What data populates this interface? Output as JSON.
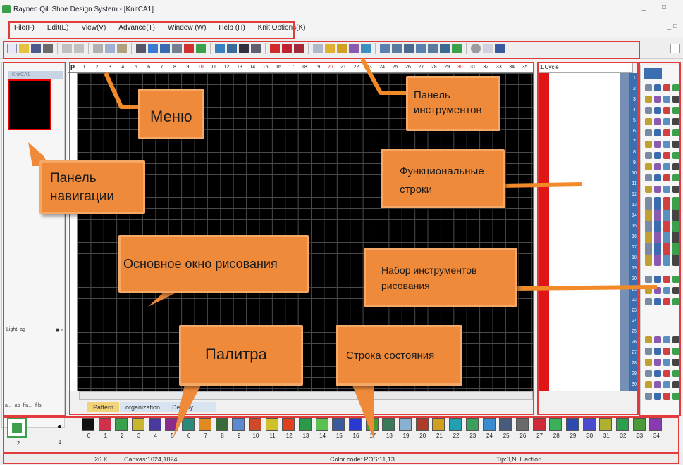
{
  "window": {
    "title": "Raynen Qili Shoe Design System - [KnitCA1]",
    "controls": "_ □"
  },
  "menu": {
    "items": [
      "File(F)",
      "Edit(E)",
      "View(V)",
      "Advance(T)",
      "Window (W)",
      "Help (H)",
      "Knit Options(K)"
    ],
    "mdi_controls": "_ □"
  },
  "nav": {
    "doc_tab": "KnitCA1",
    "layer_label": "Light. ag",
    "tabs": [
      "a...",
      "ao",
      "ffa...",
      "fils"
    ]
  },
  "ruler": {
    "corner": "P",
    "numbers": [
      "1",
      "2",
      "3",
      "4",
      "5",
      "6",
      "7",
      "8",
      "9",
      "10",
      "11",
      "12",
      "13",
      "14",
      "15",
      "16",
      "17",
      "18",
      "19",
      "20",
      "21",
      "22",
      "23",
      "24",
      "25",
      "26",
      "27",
      "28",
      "29",
      "30",
      "31",
      "32",
      "33",
      "34",
      "35"
    ],
    "red_numbers": [
      "10",
      "20",
      "30"
    ]
  },
  "function_panel": {
    "header": "1.Cycle",
    "row_numbers": [
      "1",
      "2",
      "3",
      "4",
      "5",
      "6",
      "7",
      "8",
      "9",
      "10",
      "11",
      "12",
      "13",
      "14",
      "15",
      "16",
      "17",
      "18",
      "19",
      "20",
      "21",
      "22",
      "23",
      "24",
      "25",
      "26",
      "27",
      "28",
      "29",
      "30"
    ]
  },
  "bottom_tabs": [
    "Pattern",
    "organization",
    "Density",
    "..."
  ],
  "palette": {
    "first_label": "2",
    "second_label": "1",
    "swatches": [
      {
        "label": "0",
        "color": "#111111"
      },
      {
        "label": "1",
        "color": "#d0304a"
      },
      {
        "label": "2",
        "color": "#3aa04b"
      },
      {
        "label": "3",
        "color": "#c8b530"
      },
      {
        "label": "4",
        "color": "#4a3aa0"
      },
      {
        "label": "5",
        "color": "#8b2a8b"
      },
      {
        "label": "6",
        "color": "#2a8b7a"
      },
      {
        "label": "7",
        "color": "#e08a20"
      },
      {
        "label": "8",
        "color": "#3a6a3a"
      },
      {
        "label": "9",
        "color": "#5a8ad0"
      },
      {
        "label": "10",
        "color": "#d04a2a"
      },
      {
        "label": "11",
        "color": "#d0c02a"
      },
      {
        "label": "12",
        "color": "#e04020"
      },
      {
        "label": "13",
        "color": "#2a9a4a"
      },
      {
        "label": "14",
        "color": "#5ac050"
      },
      {
        "label": "15",
        "color": "#3a5aa0"
      },
      {
        "label": "16",
        "color": "#2a3ad0"
      },
      {
        "label": "17",
        "color": "#4a9a2a"
      },
      {
        "label": "18",
        "color": "#3a7a5a"
      },
      {
        "label": "19",
        "color": "#8ab0d0"
      },
      {
        "label": "20",
        "color": "#b03a2a"
      },
      {
        "label": "21",
        "color": "#d0a020"
      },
      {
        "label": "22",
        "color": "#20a0b0"
      },
      {
        "label": "23",
        "color": "#3aa05a"
      },
      {
        "label": "24",
        "color": "#3a8ad0"
      },
      {
        "label": "25",
        "color": "#4a5a7a"
      },
      {
        "label": "26",
        "color": "#6a6a6a"
      },
      {
        "label": "27",
        "color": "#d02a3a"
      },
      {
        "label": "28",
        "color": "#3ab05a"
      },
      {
        "label": "29",
        "color": "#2a4ab0"
      },
      {
        "label": "30",
        "color": "#4a4ad0"
      },
      {
        "label": "31",
        "color": "#b0b030"
      },
      {
        "label": "32",
        "color": "#2aa04a"
      },
      {
        "label": "33",
        "color": "#4a9a3a"
      },
      {
        "label": "34",
        "color": "#8a3ab0"
      }
    ]
  },
  "status": {
    "zoom": "26 X",
    "canvas": "Canvas:1024,1024",
    "color_code": "Color code: POS:11,13",
    "tip": "Tip:0,Null action"
  },
  "annotations": {
    "menu": "Меню",
    "toolbar": "Панель инструментов",
    "navigation": "Панель навигации",
    "function_rows": "Функциональные строки",
    "main_window": "Основное окно рисования",
    "drawing_tools": "Набор инструментов рисования",
    "palette": "Палитра",
    "status_bar": "Строка состояния"
  },
  "colors": {
    "callout": "#ef8a3a",
    "highlight": "#e23b3b",
    "function_strip": "#e01515"
  }
}
